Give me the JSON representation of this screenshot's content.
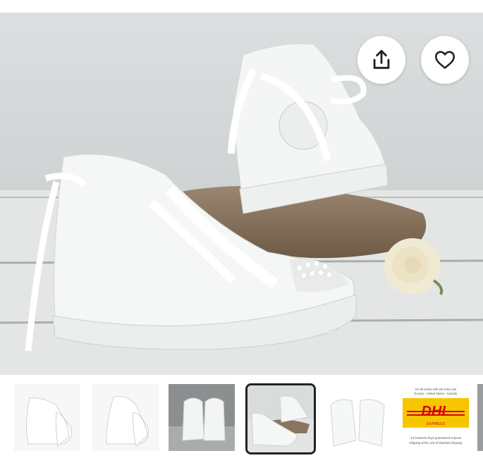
{
  "main_image": {
    "alt": "",
    "share_icon": "share-icon",
    "favorite_icon": "heart-icon"
  },
  "thumbnails": {
    "selected_index": 3,
    "items": [
      {
        "icon": "thumbnail-shoe-side"
      },
      {
        "icon": "thumbnail-shoe-side"
      },
      {
        "icon": "thumbnail-shoes-back"
      },
      {
        "icon": "thumbnail-shoes-driftwood"
      },
      {
        "icon": "thumbnail-shoes-top"
      },
      {
        "icon": "thumbnail-dhl-shipping"
      },
      {
        "icon": "thumbnail-partial"
      }
    ],
    "dhl": {
      "top_text_1": "On all orders with 3/5 extra cost",
      "top_text_2": "Europe - United States - Canada",
      "logo": "DHL",
      "express": "EXPRESS",
      "bottom_text_1": "3-5 business days guaranteed express",
      "bottom_text_2": "shipping at the cost of standard shipping"
    }
  },
  "colors": {
    "dhl_yellow": "#f7c600",
    "dhl_red": "#d40511",
    "selected_border": "#222222"
  }
}
